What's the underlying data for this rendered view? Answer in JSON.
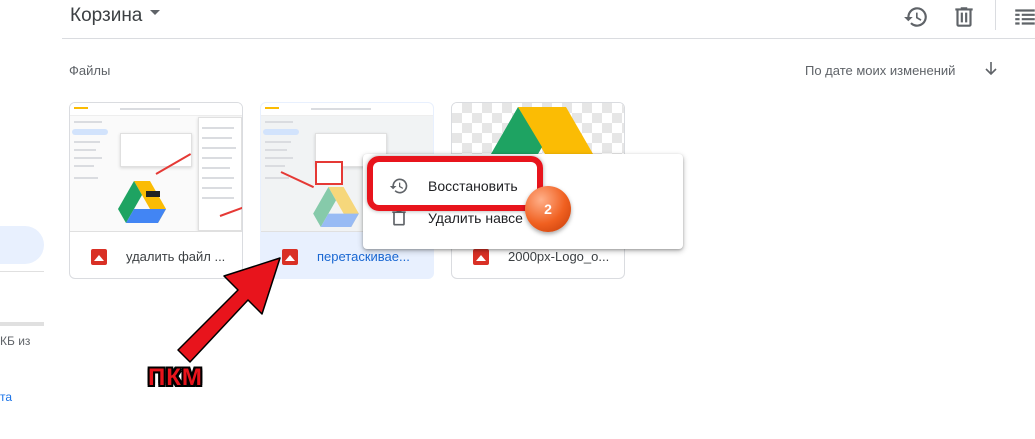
{
  "header": {
    "title": "Корзина",
    "icons": [
      "history-icon",
      "trash-icon",
      "list-view-icon"
    ]
  },
  "sidebar": {
    "storage_text": "КБ из",
    "link_text": "та"
  },
  "files_section": {
    "label": "Файлы",
    "sort_label": "По дате моих изменений",
    "sort_direction": "down"
  },
  "files": [
    {
      "name": "удалить файл ...",
      "type": "image",
      "selected": false
    },
    {
      "name": "перетаскивае...",
      "type": "image",
      "selected": true
    },
    {
      "name": "2000px-Logo_o...",
      "type": "image",
      "selected": false
    }
  ],
  "context_menu": {
    "items": [
      {
        "label": "Восстановить",
        "icon": "restore-icon"
      },
      {
        "label": "Удалить навсе",
        "icon": "delete-forever-icon"
      }
    ]
  },
  "annotations": {
    "step_badge": "2",
    "right_click_label": "ПКМ",
    "highlight_color": "#e8141c"
  },
  "colors": {
    "accent": "#1a73e8",
    "selected_bg": "#e8f0fe",
    "file_icon": "#d93025"
  }
}
